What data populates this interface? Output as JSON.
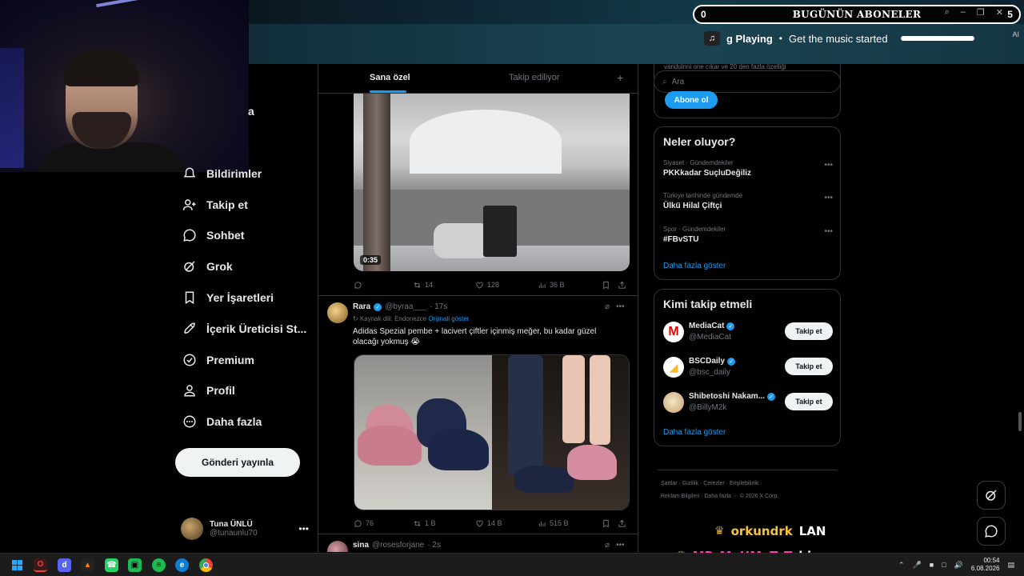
{
  "overlay": {
    "subs_count": "0",
    "subs_title": "BUGÜNÜN ABONELER",
    "subs_right": "5",
    "music_now_playing": "g Playing",
    "music_text": "Get the music started",
    "ai_label": "AI"
  },
  "nav": {
    "handle_tail": "a",
    "items": [
      {
        "label": "Bildirimler",
        "icon": "bell-icon"
      },
      {
        "label": "Takip et",
        "icon": "add-user-icon"
      },
      {
        "label": "Sohbet",
        "icon": "chat-icon"
      },
      {
        "label": "Grok",
        "icon": "grok-icon"
      },
      {
        "label": "Yer İşaretleri",
        "icon": "bookmark-icon"
      },
      {
        "label": "İçerik Üreticisi St...",
        "icon": "rocket-icon"
      },
      {
        "label": "Premium",
        "icon": "premium-icon"
      },
      {
        "label": "Profil",
        "icon": "profile-icon"
      },
      {
        "label": "Daha fazla",
        "icon": "more-circle-icon"
      }
    ],
    "post_button": "Gönderi yayınla",
    "me": {
      "name": "Tuna ÜNLÜ",
      "handle": "@tunaunlu70",
      "more": "•••"
    }
  },
  "timeline": {
    "tabs": [
      "Sana özel",
      "Takip ediliyor"
    ],
    "tab_plus": "+",
    "tweet1": {
      "video_time": "0:35",
      "reply": "",
      "retweets": "14",
      "likes": "128",
      "views": "36 B"
    },
    "tweet2": {
      "name": "Rara",
      "handle": "@byraa___",
      "time": "· 17s",
      "translated_note": "Kaynak dili: Endonezce",
      "translated_link": "Orijinali göster",
      "text": "Adidas Spezial pembe + lacivert çiftler içinmiş meğer, bu kadar güzel olacağı yokmuş 😭",
      "replies": "76",
      "retweets": "1 B",
      "likes": "14 B",
      "views": "515 B"
    },
    "tweet3": {
      "name": "sina",
      "handle": "@rosesforjane",
      "time": "· 2s"
    }
  },
  "right": {
    "premium_cut_text": "vanduinni one cıkar ve 20 den fazla özelliği",
    "search_placeholder": "Ara",
    "subscribe_button": "Abone ol",
    "whats_happening": {
      "title": "Neler oluyor?",
      "trends": [
        {
          "category": "Siyaset · Gündemdekiler",
          "title": "PKKkadar SuçluDeğiliz"
        },
        {
          "category": "Türkiye tarihinde gündemde",
          "title": "Ülkü Hilal Çiftçi"
        },
        {
          "category": "Spor · Gündemdekiler",
          "title": "#FBvSTU"
        }
      ],
      "show_more": "Daha fazla göster"
    },
    "who_to_follow": {
      "title": "Kimi takip etmeli",
      "accounts": [
        {
          "name": "MediaCat",
          "handle": "@MediaCat",
          "button": "Takip et",
          "color": "#e10600"
        },
        {
          "name": "BSCDaily",
          "handle": "@bsc_daily",
          "button": "Takip et",
          "color": "#f3ba2f"
        },
        {
          "name": "Shibetoshi Nakam...",
          "handle": "@BillyM2k",
          "button": "Takip et",
          "color": "#c8a06a"
        }
      ],
      "show_more": "Daha fazla göster"
    },
    "footer": {
      "line1": "Şartlar  ·  Gizlilik  ·  Çerezler  ·  Erişilebilirlik  ·",
      "line2": "Reklam Bilgileri  ·  Daha fazla ···  © 2026 X Corp."
    }
  },
  "chat": [
    {
      "user": "orkundrk",
      "message": "LAN"
    },
    {
      "user": "MR_MeHMeT_T",
      "message": "bizene aq"
    }
  ],
  "taskbar": {
    "time": "00:54",
    "date": "6.08.2026"
  },
  "colors": {
    "accent": "#1d9bf0",
    "border": "#2f3336",
    "muted": "#71767b"
  }
}
